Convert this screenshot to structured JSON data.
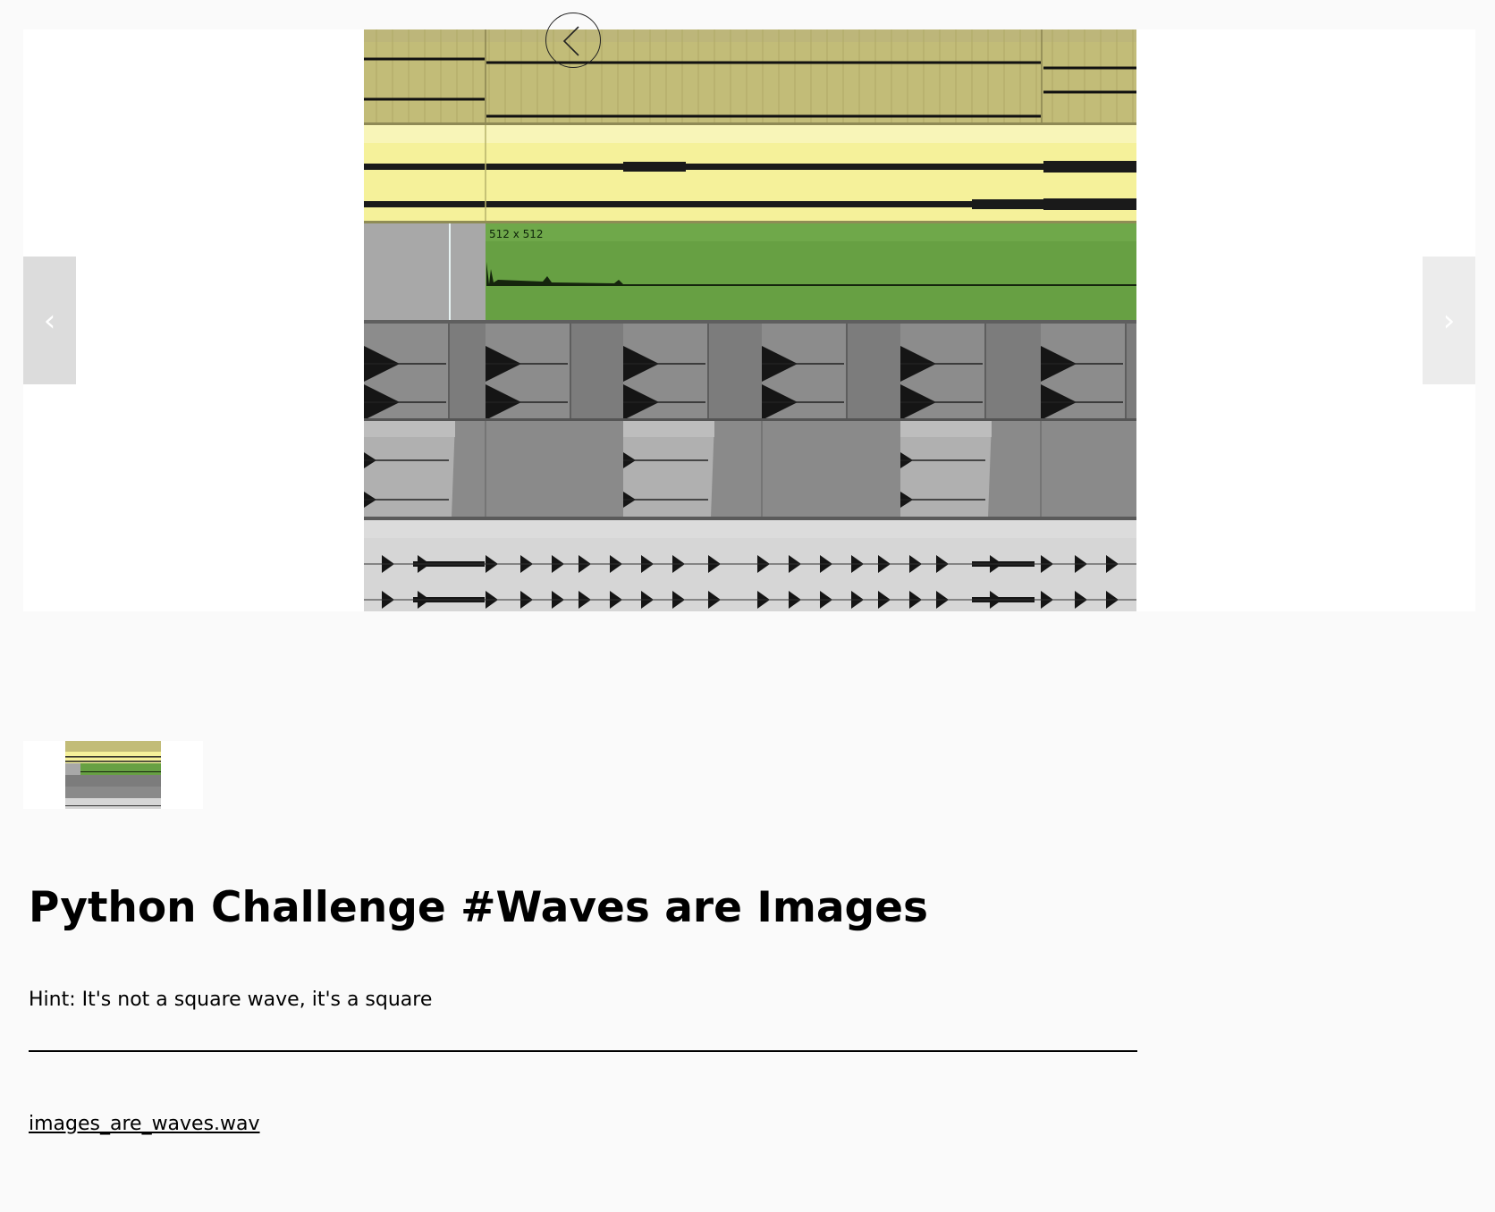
{
  "gallery": {
    "prev_glyph": "‹",
    "next_glyph": "›",
    "back_icon": "chevron-left-icon",
    "image_overlay_label": "512 x 512",
    "thumbnail_count": 1
  },
  "post": {
    "title": "Python Challenge #Waves are Images",
    "hint": "Hint: It's not a square wave, it's a square",
    "attachment": "images_are_waves.wav"
  },
  "colors": {
    "track_olive": "#c2bc78",
    "track_yellow": "#f5f19a",
    "track_green": "#67a043",
    "track_grey": "#8a8a8a",
    "track_light": "#d6d6d6"
  }
}
